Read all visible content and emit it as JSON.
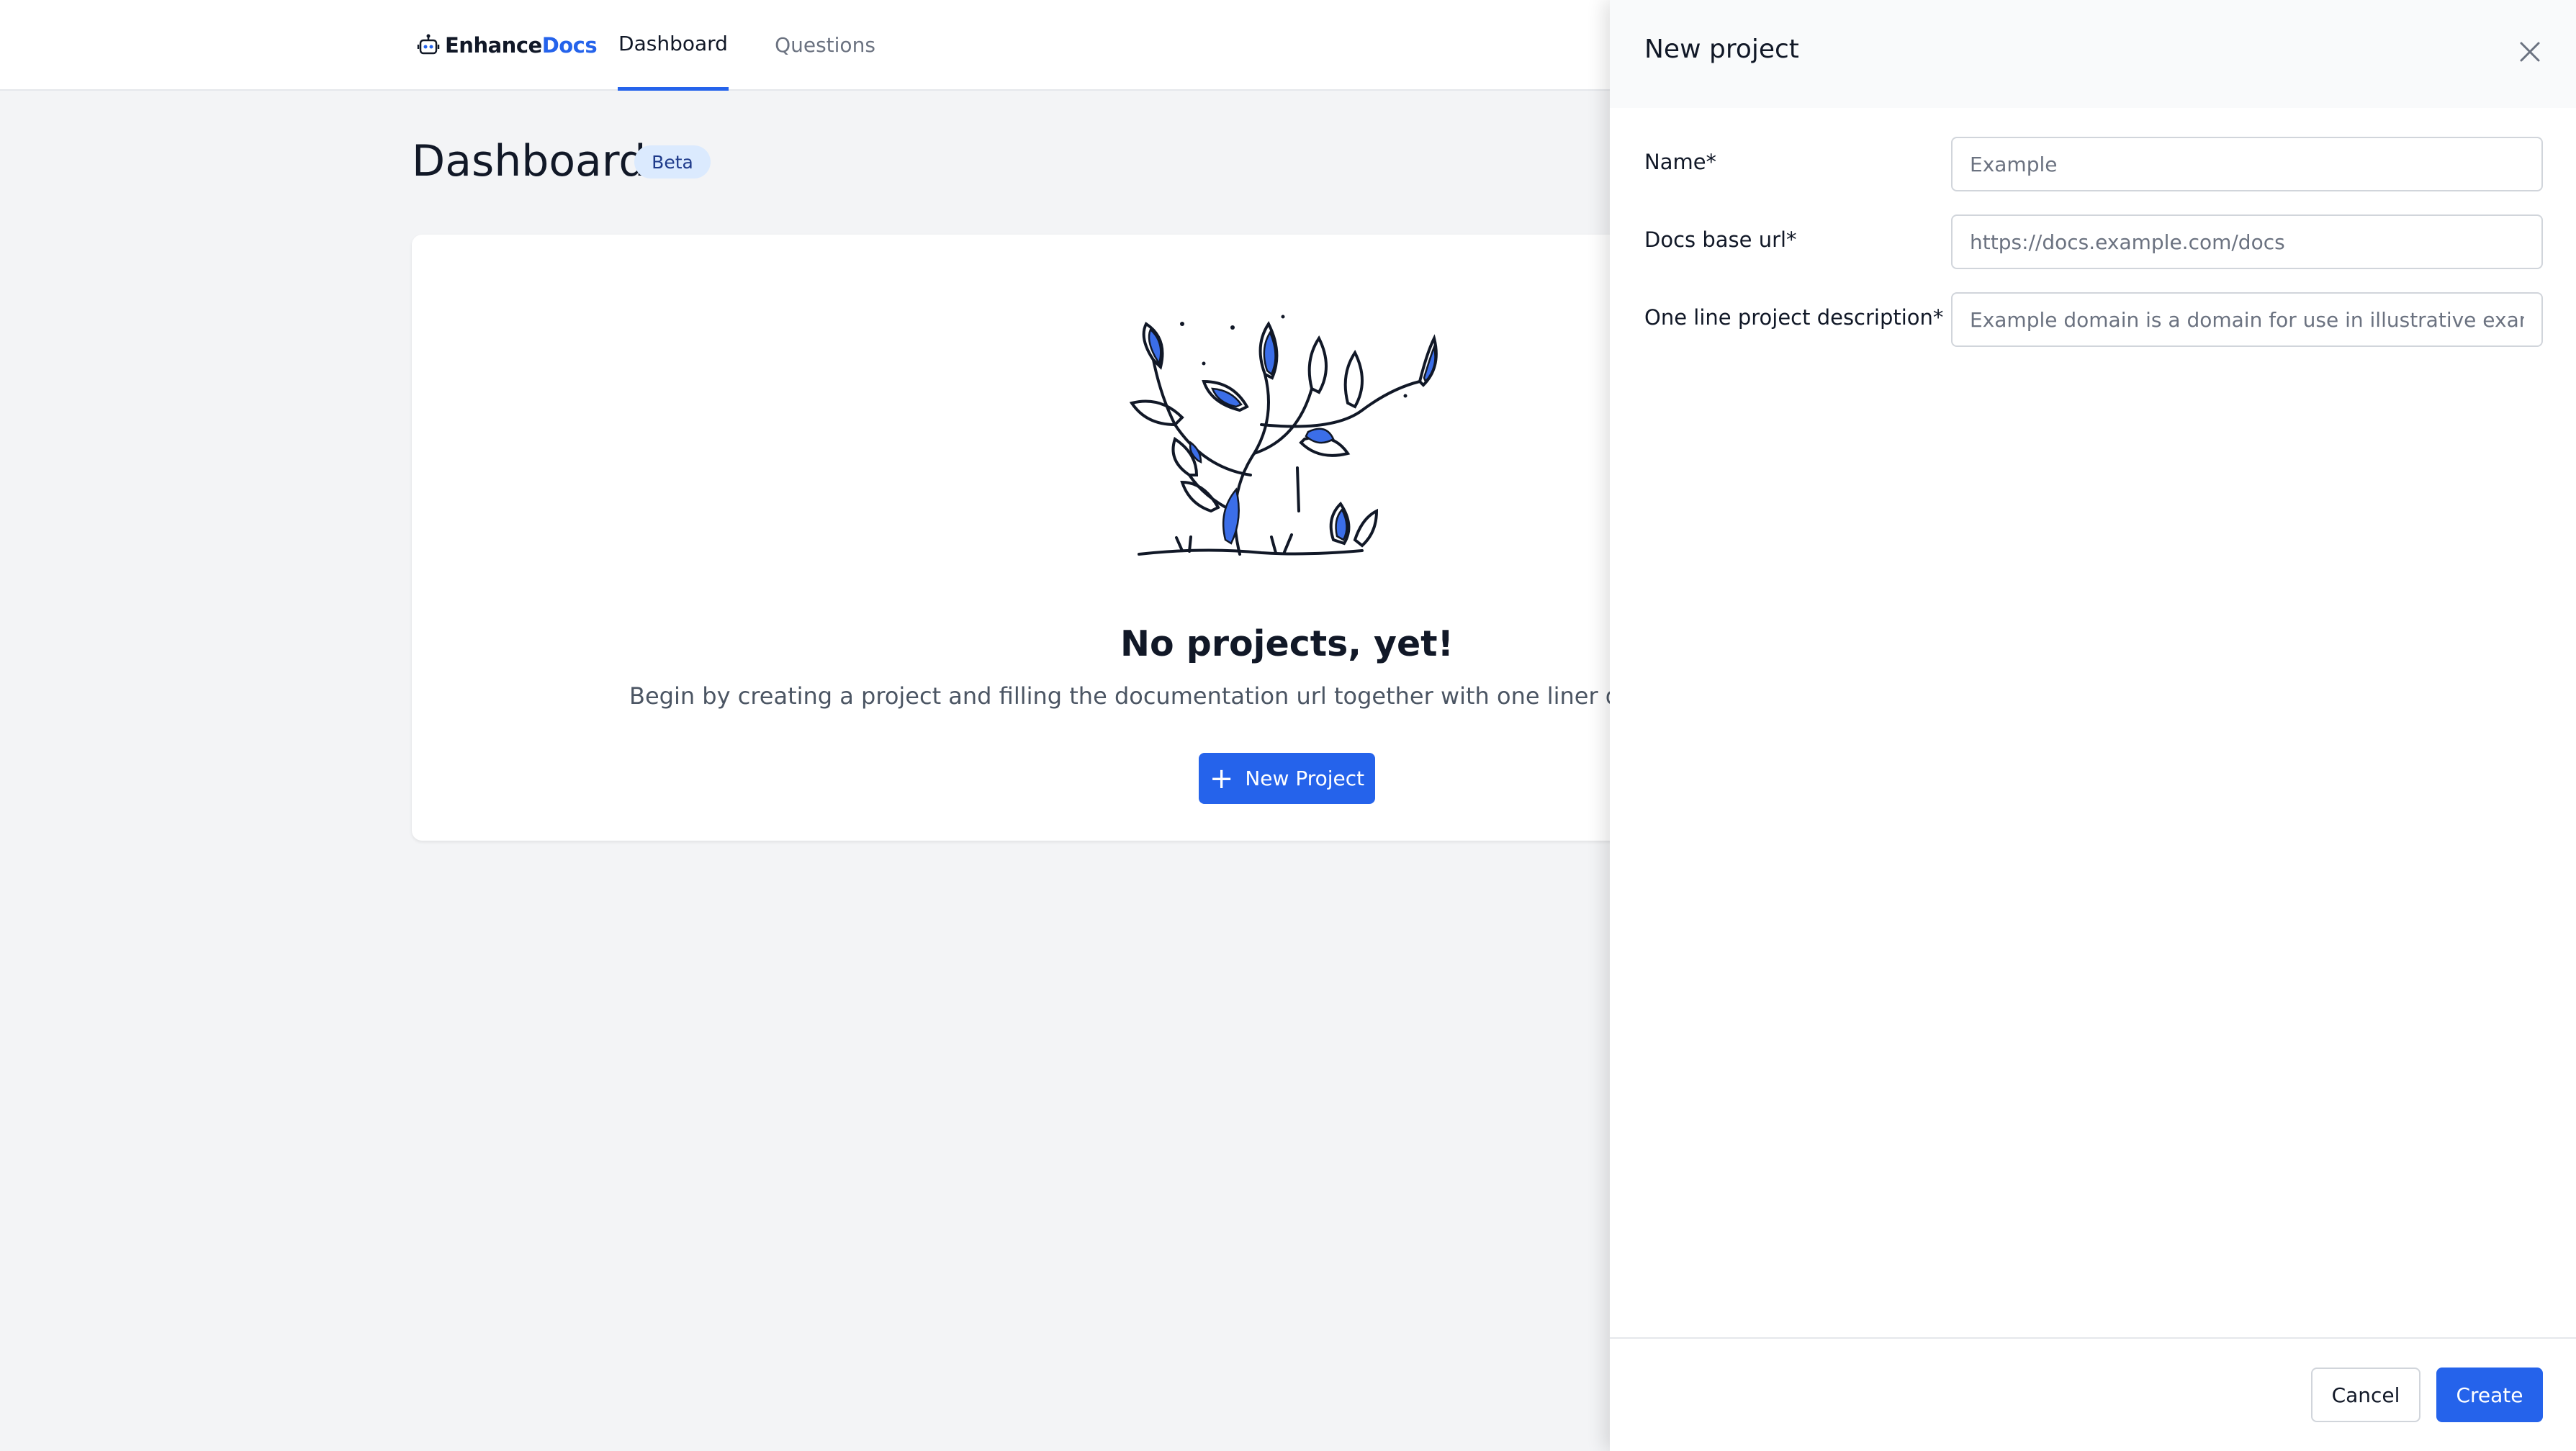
{
  "brand": {
    "name_part1": "Enhance",
    "name_part2": "Docs",
    "logo_icon": "robot-docs-icon",
    "accent_color": "#2563eb"
  },
  "nav": {
    "tabs": [
      {
        "label": "Dashboard",
        "active": true
      },
      {
        "label": "Questions",
        "active": false
      }
    ]
  },
  "page": {
    "title": "Dashboard",
    "badge": "Beta"
  },
  "empty_state": {
    "illustration": "plant-illustration",
    "title": "No projects, yet!",
    "description": "Begin by creating a project and filling the documentation url together with one liner description.",
    "button_label": "New Project",
    "button_icon": "plus-icon"
  },
  "panel": {
    "title": "New project",
    "close_icon": "close-icon",
    "fields": [
      {
        "label": "Name*",
        "placeholder": "Example",
        "value": ""
      },
      {
        "label": "Docs base url*",
        "placeholder": "https://docs.example.com/docs",
        "value": ""
      },
      {
        "label": "One line project description*",
        "placeholder": "Example domain is a domain for use in illustrative examples",
        "value": ""
      }
    ],
    "cancel_label": "Cancel",
    "create_label": "Create"
  }
}
